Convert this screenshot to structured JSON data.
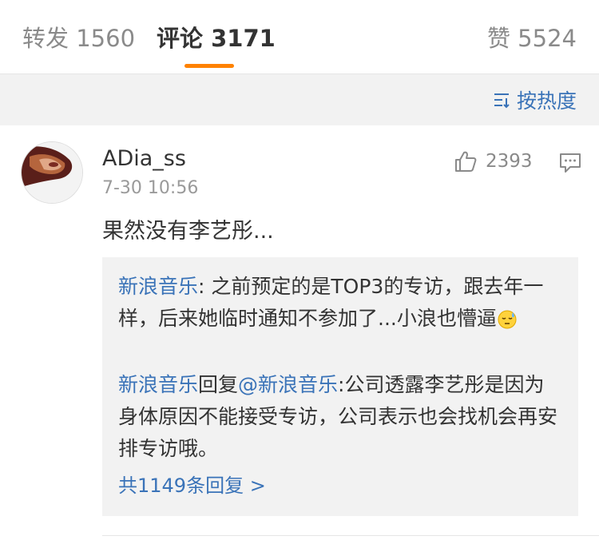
{
  "tabs": {
    "repost": "转发 1560",
    "comments": "评论 3171",
    "likes": "赞 5524"
  },
  "sort": {
    "label": "按热度"
  },
  "comment": {
    "username": "ADia_ss",
    "time": "7-30 10:56",
    "like_count": "2393",
    "text": "果然没有李艺彤...",
    "replies": [
      {
        "author": "新浪音乐",
        "separator": ": ",
        "text": "之前预定的是TOP3的专访，跟去年一样，后来她临时通知不参加了...小浪也懵逼",
        "emoji": "sweat-face-icon"
      },
      {
        "author": "新浪音乐",
        "reply_word": "回复",
        "mention": "@新浪音乐",
        "text": ":公司透露李艺彤是因为身体原因不能接受专访，公司表示也会找机会再安排专访哦。"
      }
    ],
    "more_replies": "共1149条回复 >"
  },
  "colors": {
    "accent": "#ff8200",
    "link": "#3a73b8",
    "muted": "#8a8a8a",
    "background_band": "#f2f2f2"
  }
}
